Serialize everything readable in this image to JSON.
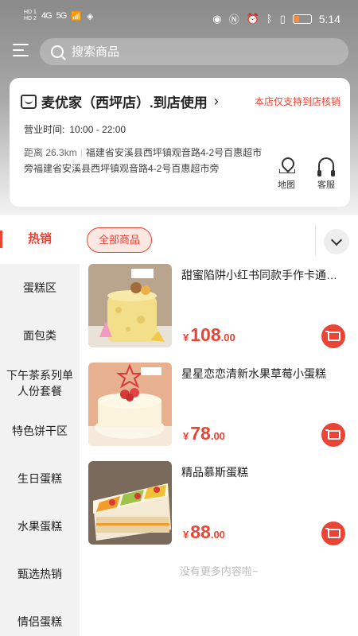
{
  "status_bar": {
    "left": {
      "hd1": "HD 1",
      "hd2": "HD 2",
      "sig1": "4G",
      "sig2": "5G"
    },
    "time": "5:14"
  },
  "search": {
    "placeholder": "搜索商品"
  },
  "store": {
    "name": "麦优家（西坪店）.到店使用",
    "note": "本店仅支持到店核销",
    "hours_label": "营业时间:",
    "hours_value": "10:00 - 22:00",
    "distance": "距离 26.3km",
    "address": "福建省安溪县西坪镇观音路4-2号百惠超市旁福建省安溪县西坪镇观音路4-2号百惠超市旁",
    "map_label": "地图",
    "service_label": "客服"
  },
  "tabs": {
    "hot": "热销",
    "all": "全部商品"
  },
  "sidebar": {
    "items": [
      {
        "label": "蛋糕区"
      },
      {
        "label": "面包类"
      },
      {
        "label": "下午茶系列单人份套餐"
      },
      {
        "label": "特色饼干区"
      },
      {
        "label": "生日蛋糕"
      },
      {
        "label": "水果蛋糕"
      },
      {
        "label": "甄选热销"
      },
      {
        "label": "情侣蛋糕"
      }
    ]
  },
  "products": [
    {
      "name": "甜蜜陷阱小红书同款手作卡通蛋糕",
      "currency": "¥",
      "price_int": "108",
      "price_dec": ".00",
      "image": "cheese-cake-with-bear-toppers"
    },
    {
      "name": "星星恋恋清新水果草莓小蛋糕",
      "currency": "¥",
      "price_int": "78",
      "price_dec": ".00",
      "image": "strawberry-cream-cake-with-star"
    },
    {
      "name": "精品慕斯蛋糕",
      "currency": "¥",
      "price_int": "88",
      "price_dec": ".00",
      "image": "fruit-mousse-sheet-cake"
    }
  ],
  "no_more": "没有更多内容啦~",
  "colors": {
    "accent": "#e94435",
    "pill_bg": "#fde7e3"
  }
}
